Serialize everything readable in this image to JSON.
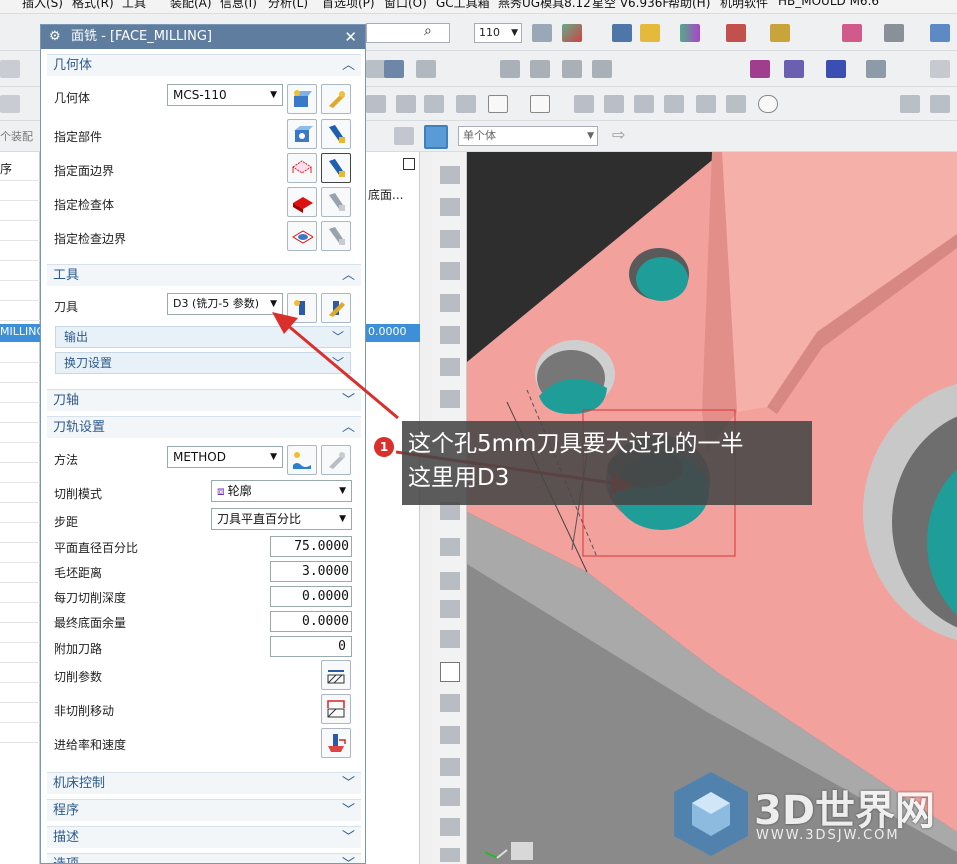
{
  "menubar": {
    "items": [
      "插入(S)",
      "格式(R)",
      "工具",
      "装配(A)",
      "信息(I)",
      "分析(L)",
      "首选项(P)",
      "窗口(O)",
      "GC工具箱",
      "燕秀UG模具8.12",
      "星空 V6.936F",
      "帮助(H)",
      "机明软件",
      "HB_MOULD M6.6"
    ]
  },
  "toolbar": {
    "zoom_value": "110",
    "filter_value": "单个体",
    "left_clip_text": "个装配"
  },
  "bgtable": {
    "header_left": "序",
    "header_right": "底面...",
    "row_left": "MILLING",
    "row_right": "0.0000"
  },
  "dialog": {
    "title": "面铣 - [FACE_MILLING]",
    "close": "✕",
    "geometry": {
      "header": "几何体",
      "geometry_label": "几何体",
      "geometry_value": "MCS-110",
      "part_label": "指定部件",
      "face_boundary_label": "指定面边界",
      "check_body_label": "指定检查体",
      "check_boundary_label": "指定检查边界"
    },
    "tool": {
      "header": "工具",
      "tool_label": "刀具",
      "tool_value": "D3 (铣刀-5 参数)",
      "output_label": "输出",
      "tool_change_label": "换刀设置"
    },
    "axis": {
      "header": "刀轴"
    },
    "path": {
      "header": "刀轨设置",
      "method_label": "方法",
      "method_value": "METHOD",
      "cut_pattern_label": "切削模式",
      "cut_pattern_value": "轮廓",
      "stepover_label": "步距",
      "stepover_value": "刀具平直百分比",
      "flat_diameter_label": "平面直径百分比",
      "flat_diameter_value": "75.0000",
      "blank_distance_label": "毛坯距离",
      "blank_distance_value": "3.0000",
      "depth_per_cut_label": "每刀切削深度",
      "depth_per_cut_value": "0.0000",
      "final_floor_stock_label": "最终底面余量",
      "final_floor_stock_value": "0.0000",
      "extra_passes_label": "附加刀路",
      "extra_passes_value": "0",
      "cut_params_label": "切削参数",
      "non_cut_moves_label": "非切削移动",
      "feeds_speeds_label": "进给率和速度"
    },
    "machine_control": {
      "header": "机床控制"
    },
    "program": {
      "header": "程序"
    },
    "description": {
      "header": "描述"
    },
    "options": {
      "header": "选项"
    }
  },
  "annotation": {
    "badge": "1",
    "line1": "这个孔5mm刀具要大过孔的一半",
    "line2": "这里用D3"
  },
  "watermark": {
    "brand": "3D世界网",
    "url": "WWW.3DSJW.COM"
  },
  "colors": {
    "dialog_title_bg": "#5f7e9f",
    "section_text": "#2c5a8c",
    "part_face": "#f2a19c",
    "hole_fill": "#1f9d98",
    "annotation_red": "#d9302c"
  }
}
